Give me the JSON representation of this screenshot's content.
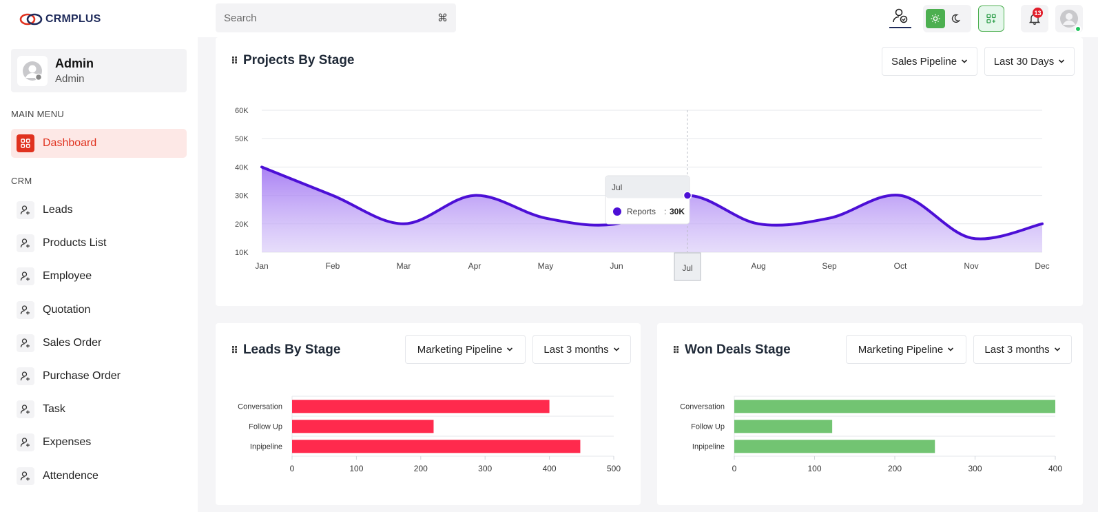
{
  "brand": {
    "name": "CRMPLUS"
  },
  "search": {
    "placeholder": "Search",
    "shortcut": "⌘"
  },
  "header": {
    "notification_count": "13"
  },
  "profile": {
    "name": "Admin",
    "role": "Admin"
  },
  "sidebar": {
    "main_menu_title": "MAIN MENU",
    "crm_title": "CRM",
    "main_items": [
      {
        "label": "Dashboard"
      }
    ],
    "crm_items": [
      {
        "label": "Leads"
      },
      {
        "label": "Products List"
      },
      {
        "label": "Employee"
      },
      {
        "label": "Quotation"
      },
      {
        "label": "Sales Order"
      },
      {
        "label": "Purchase Order"
      },
      {
        "label": "Task"
      },
      {
        "label": "Expenses"
      },
      {
        "label": "Attendence"
      }
    ]
  },
  "projects_card": {
    "title": "Projects By Stage",
    "pipeline_dropdown": "Sales Pipeline",
    "period_dropdown": "Last 30 Days",
    "tooltip": {
      "month": "Jul",
      "series": "Reports",
      "value": "30K"
    }
  },
  "leads_card": {
    "title": "Leads By Stage",
    "pipeline_dropdown": "Marketing Pipeline",
    "period_dropdown": "Last 3 months"
  },
  "won_card": {
    "title": "Won Deals Stage",
    "pipeline_dropdown": "Marketing Pipeline",
    "period_dropdown": "Last 3 months"
  },
  "colors": {
    "accent": "#e0321f",
    "line": "#4c0fd6",
    "leads_bar": "#ff2a4d",
    "won_bar": "#72c472"
  },
  "chart_data": [
    {
      "type": "area",
      "title": "Projects By Stage",
      "categories": [
        "Jan",
        "Feb",
        "Mar",
        "Apr",
        "May",
        "Jun",
        "Jul",
        "Aug",
        "Sep",
        "Oct",
        "Nov",
        "Dec"
      ],
      "series": [
        {
          "name": "Reports",
          "values": [
            40,
            30,
            20,
            30,
            22,
            20,
            30,
            20,
            22,
            30,
            15,
            20
          ]
        }
      ],
      "y_ticks": [
        "10K",
        "20K",
        "30K",
        "40K",
        "50K",
        "60K"
      ],
      "ylim": [
        10,
        60
      ],
      "unit": "K",
      "grid": true,
      "highlight_category": "Jul"
    },
    {
      "type": "bar",
      "title": "Leads By Stage",
      "orientation": "horizontal",
      "categories": [
        "Conversation",
        "Follow Up",
        "Inpipeline"
      ],
      "values": [
        400,
        220,
        448
      ],
      "x_ticks": [
        "0",
        "100",
        "200",
        "300",
        "400",
        "500"
      ],
      "xlim": [
        0,
        500
      ]
    },
    {
      "type": "bar",
      "title": "Won Deals Stage",
      "orientation": "horizontal",
      "categories": [
        "Conversation",
        "Follow Up",
        "Inpipeline"
      ],
      "values": [
        400,
        122,
        250
      ],
      "x_ticks": [
        "0",
        "100",
        "200",
        "300",
        "400"
      ],
      "xlim": [
        0,
        400
      ]
    }
  ]
}
